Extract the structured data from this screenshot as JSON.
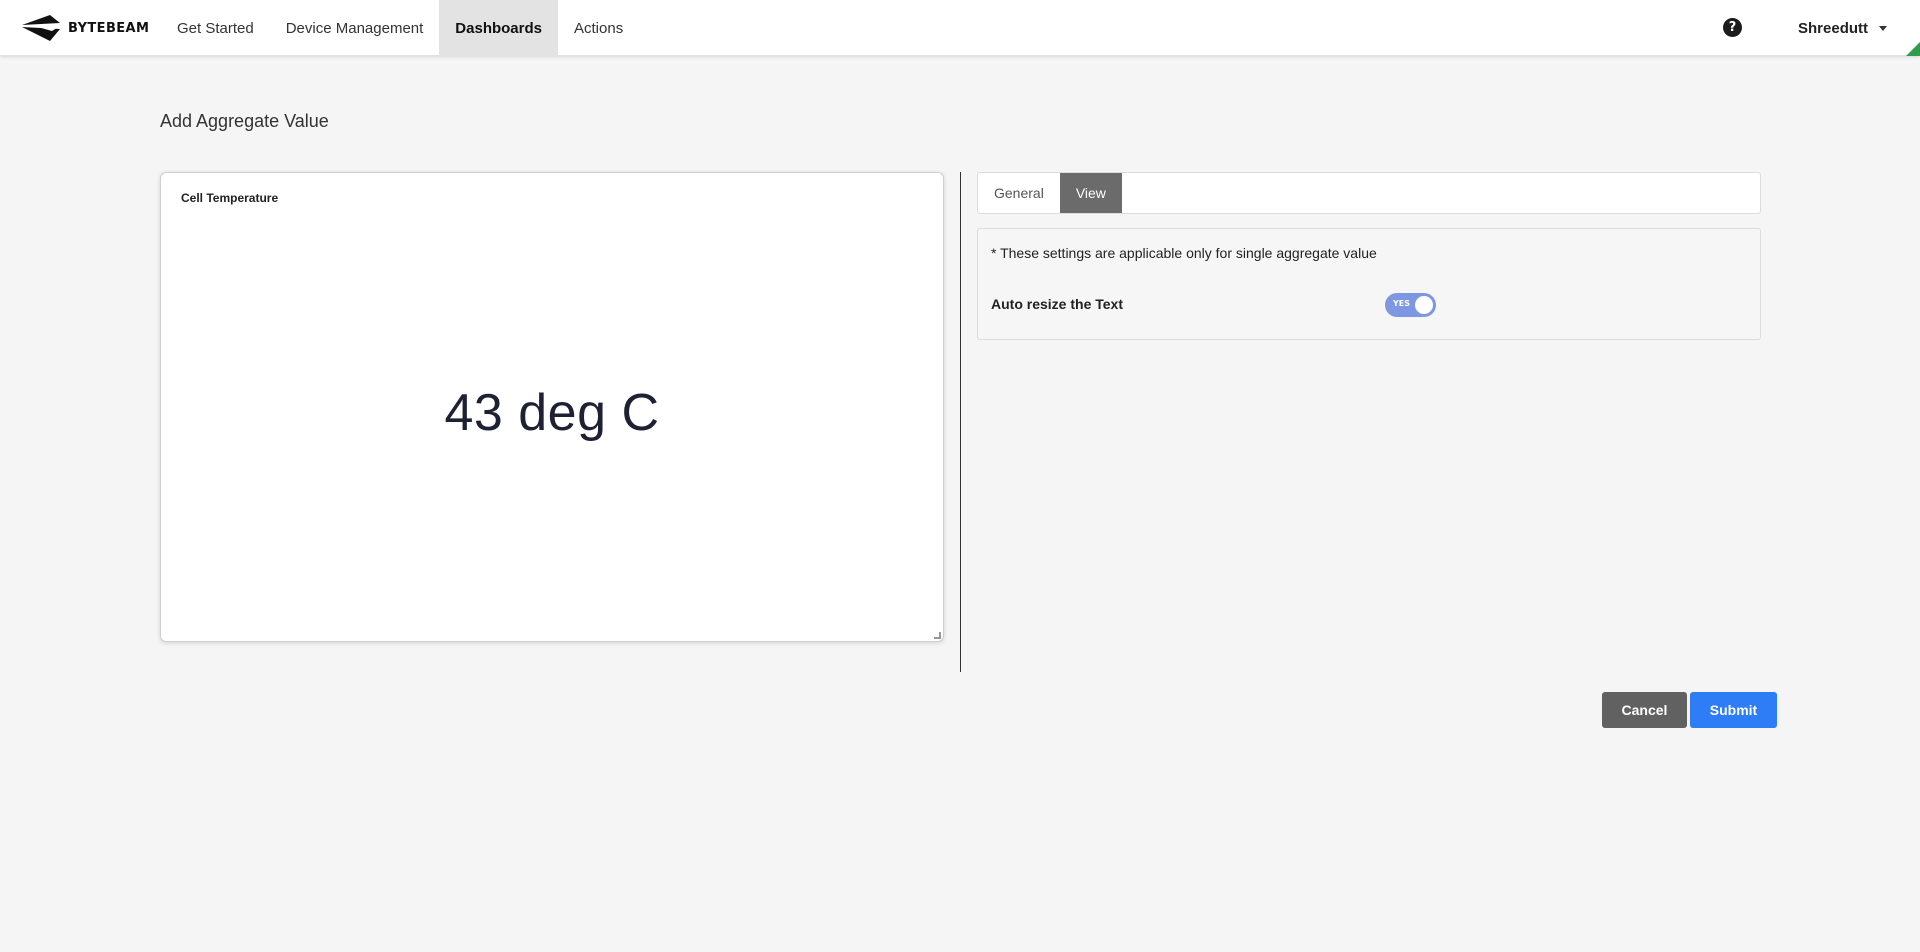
{
  "brand": {
    "name": "BYTEBEAM",
    "logo_icon": "bytebeam-arrow-logo"
  },
  "nav": {
    "items": [
      {
        "label": "Get Started",
        "active": false
      },
      {
        "label": "Device Management",
        "active": false
      },
      {
        "label": "Dashboards",
        "active": true
      },
      {
        "label": "Actions",
        "active": false
      }
    ]
  },
  "header": {
    "help_icon": "?",
    "user_name": "Shreedutt"
  },
  "page": {
    "title": "Add Aggregate Value"
  },
  "preview": {
    "title": "Cell Temperature",
    "value": "43 deg C"
  },
  "tabs": [
    {
      "label": "General",
      "active": false
    },
    {
      "label": "View",
      "active": true
    }
  ],
  "settings": {
    "note": "* These settings are applicable only for single aggregate value",
    "auto_resize_label": "Auto resize the Text",
    "auto_resize_toggle_text": "YES",
    "auto_resize_enabled": true
  },
  "actions": {
    "cancel_label": "Cancel",
    "submit_label": "Submit"
  },
  "colors": {
    "submit_button": "#2e7cf6",
    "cancel_button": "#616161",
    "toggle_on": "#7e97e2",
    "active_tab": "#6b6b6b",
    "corner_indicator": "#2e9e4a"
  }
}
